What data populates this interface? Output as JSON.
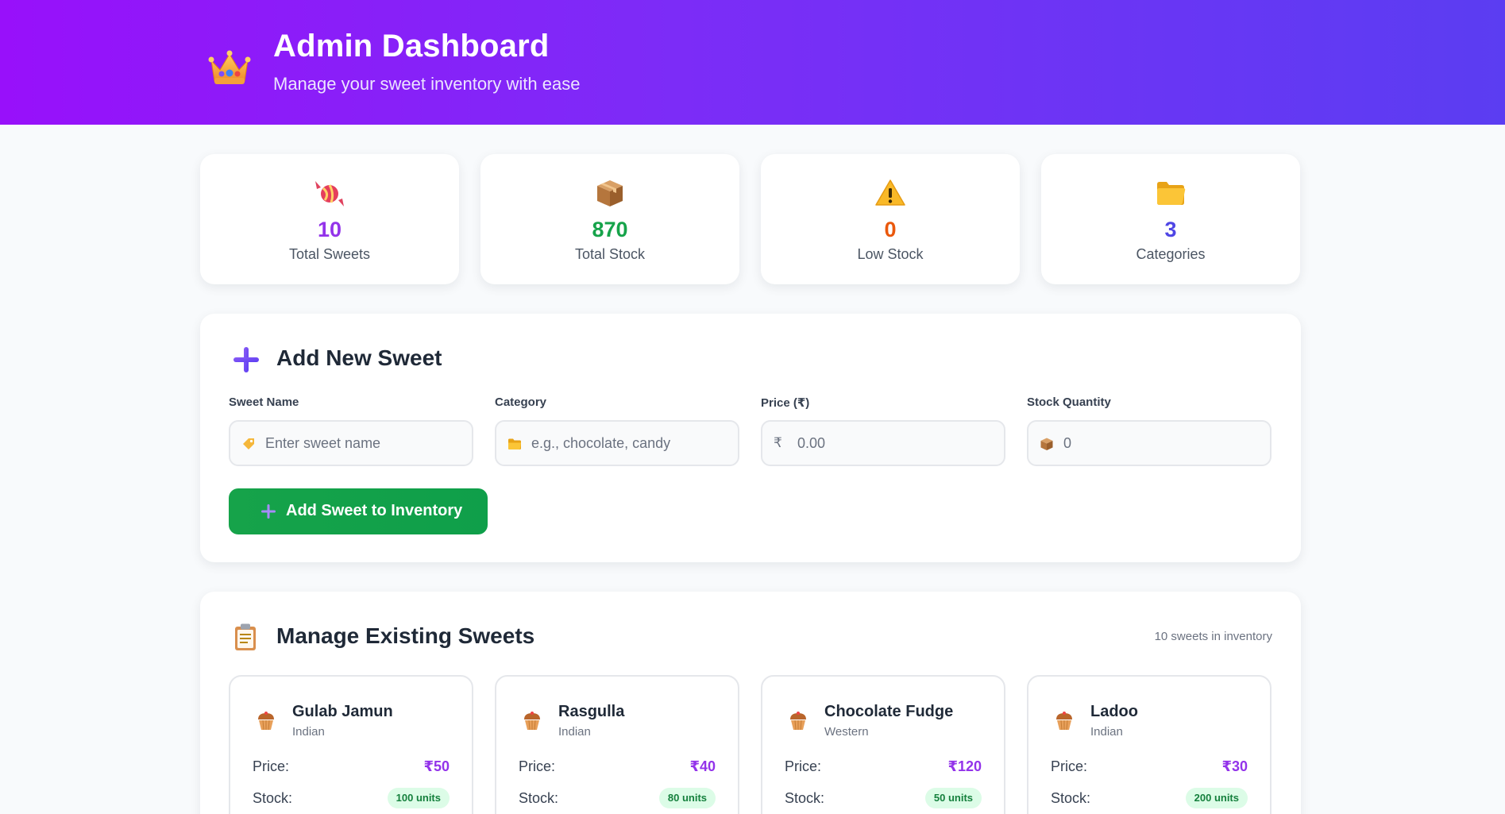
{
  "header": {
    "title": "Admin Dashboard",
    "subtitle": "Manage your sweet inventory with ease",
    "icon": "crown-icon"
  },
  "stats": [
    {
      "icon": "candy-icon",
      "value": "10",
      "label": "Total Sweets",
      "color": "#9333ea"
    },
    {
      "icon": "box-icon",
      "value": "870",
      "label": "Total Stock",
      "color": "#16a34a"
    },
    {
      "icon": "warning-icon",
      "value": "0",
      "label": "Low Stock",
      "color": "#ea580c"
    },
    {
      "icon": "folder-icon",
      "value": "3",
      "label": "Categories",
      "color": "#4f46e5"
    }
  ],
  "add_form": {
    "title": "Add New Sweet",
    "fields": {
      "name": {
        "label": "Sweet Name",
        "placeholder": "Enter sweet name",
        "value": ""
      },
      "category": {
        "label": "Category",
        "placeholder": "e.g., chocolate, candy",
        "value": ""
      },
      "price": {
        "label": "Price (₹)",
        "placeholder": "0.00",
        "prefix": "₹",
        "value": ""
      },
      "stock": {
        "label": "Stock Quantity",
        "placeholder": "0",
        "value": ""
      }
    },
    "submit_label": "Add Sweet to Inventory"
  },
  "manage": {
    "title": "Manage Existing Sweets",
    "count_text": "10 sweets in inventory",
    "price_label": "Price:",
    "stock_label": "Stock:",
    "sweets": [
      {
        "name": "Gulab Jamun",
        "category": "Indian",
        "price": "₹50",
        "stock": "100 units"
      },
      {
        "name": "Rasgulla",
        "category": "Indian",
        "price": "₹40",
        "stock": "80 units"
      },
      {
        "name": "Chocolate Fudge",
        "category": "Western",
        "price": "₹120",
        "stock": "50 units"
      },
      {
        "name": "Ladoo",
        "category": "Indian",
        "price": "₹30",
        "stock": "200 units"
      }
    ]
  },
  "colors": {
    "header_gradient_start": "#9810fa",
    "header_gradient_end": "#5b3df2",
    "primary_button": "#16a34a",
    "price_accent": "#9333ea",
    "stock_badge_bg": "#dcfce7"
  }
}
